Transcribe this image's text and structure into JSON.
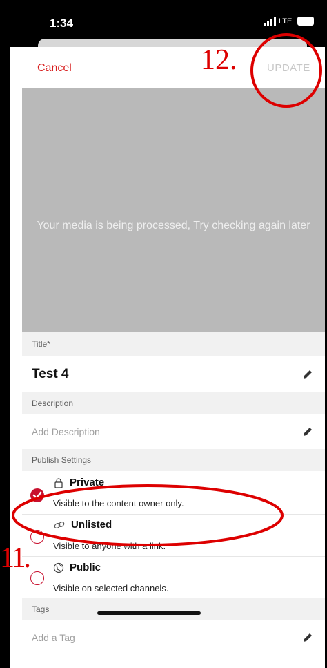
{
  "status_bar": {
    "time": "1:34",
    "network": "LTE"
  },
  "nav": {
    "cancel_label": "Cancel",
    "update_label": "UPDATE"
  },
  "media": {
    "message": "Your media is being processed, Try checking again later"
  },
  "title_section": {
    "header": "Title*",
    "value": "Test 4"
  },
  "description_section": {
    "header": "Description",
    "placeholder": "Add Description"
  },
  "publish_section": {
    "header": "Publish Settings",
    "options": [
      {
        "label": "Private",
        "description": "Visible to the content owner only.",
        "selected": true,
        "icon": "lock-icon"
      },
      {
        "label": "Unlisted",
        "description": "Visible to anyone with a link.",
        "selected": false,
        "icon": "link-icon"
      },
      {
        "label": "Public",
        "description": "Visible on selected channels.",
        "selected": false,
        "icon": "globe-icon"
      }
    ]
  },
  "tags_section": {
    "header": "Tags",
    "placeholder": "Add a Tag"
  },
  "annotations": {
    "step_update": "12.",
    "step_public": "11."
  },
  "colors": {
    "accent": "#c8102e",
    "annotation": "#dd0000",
    "media_bg": "#b9b9b9"
  }
}
